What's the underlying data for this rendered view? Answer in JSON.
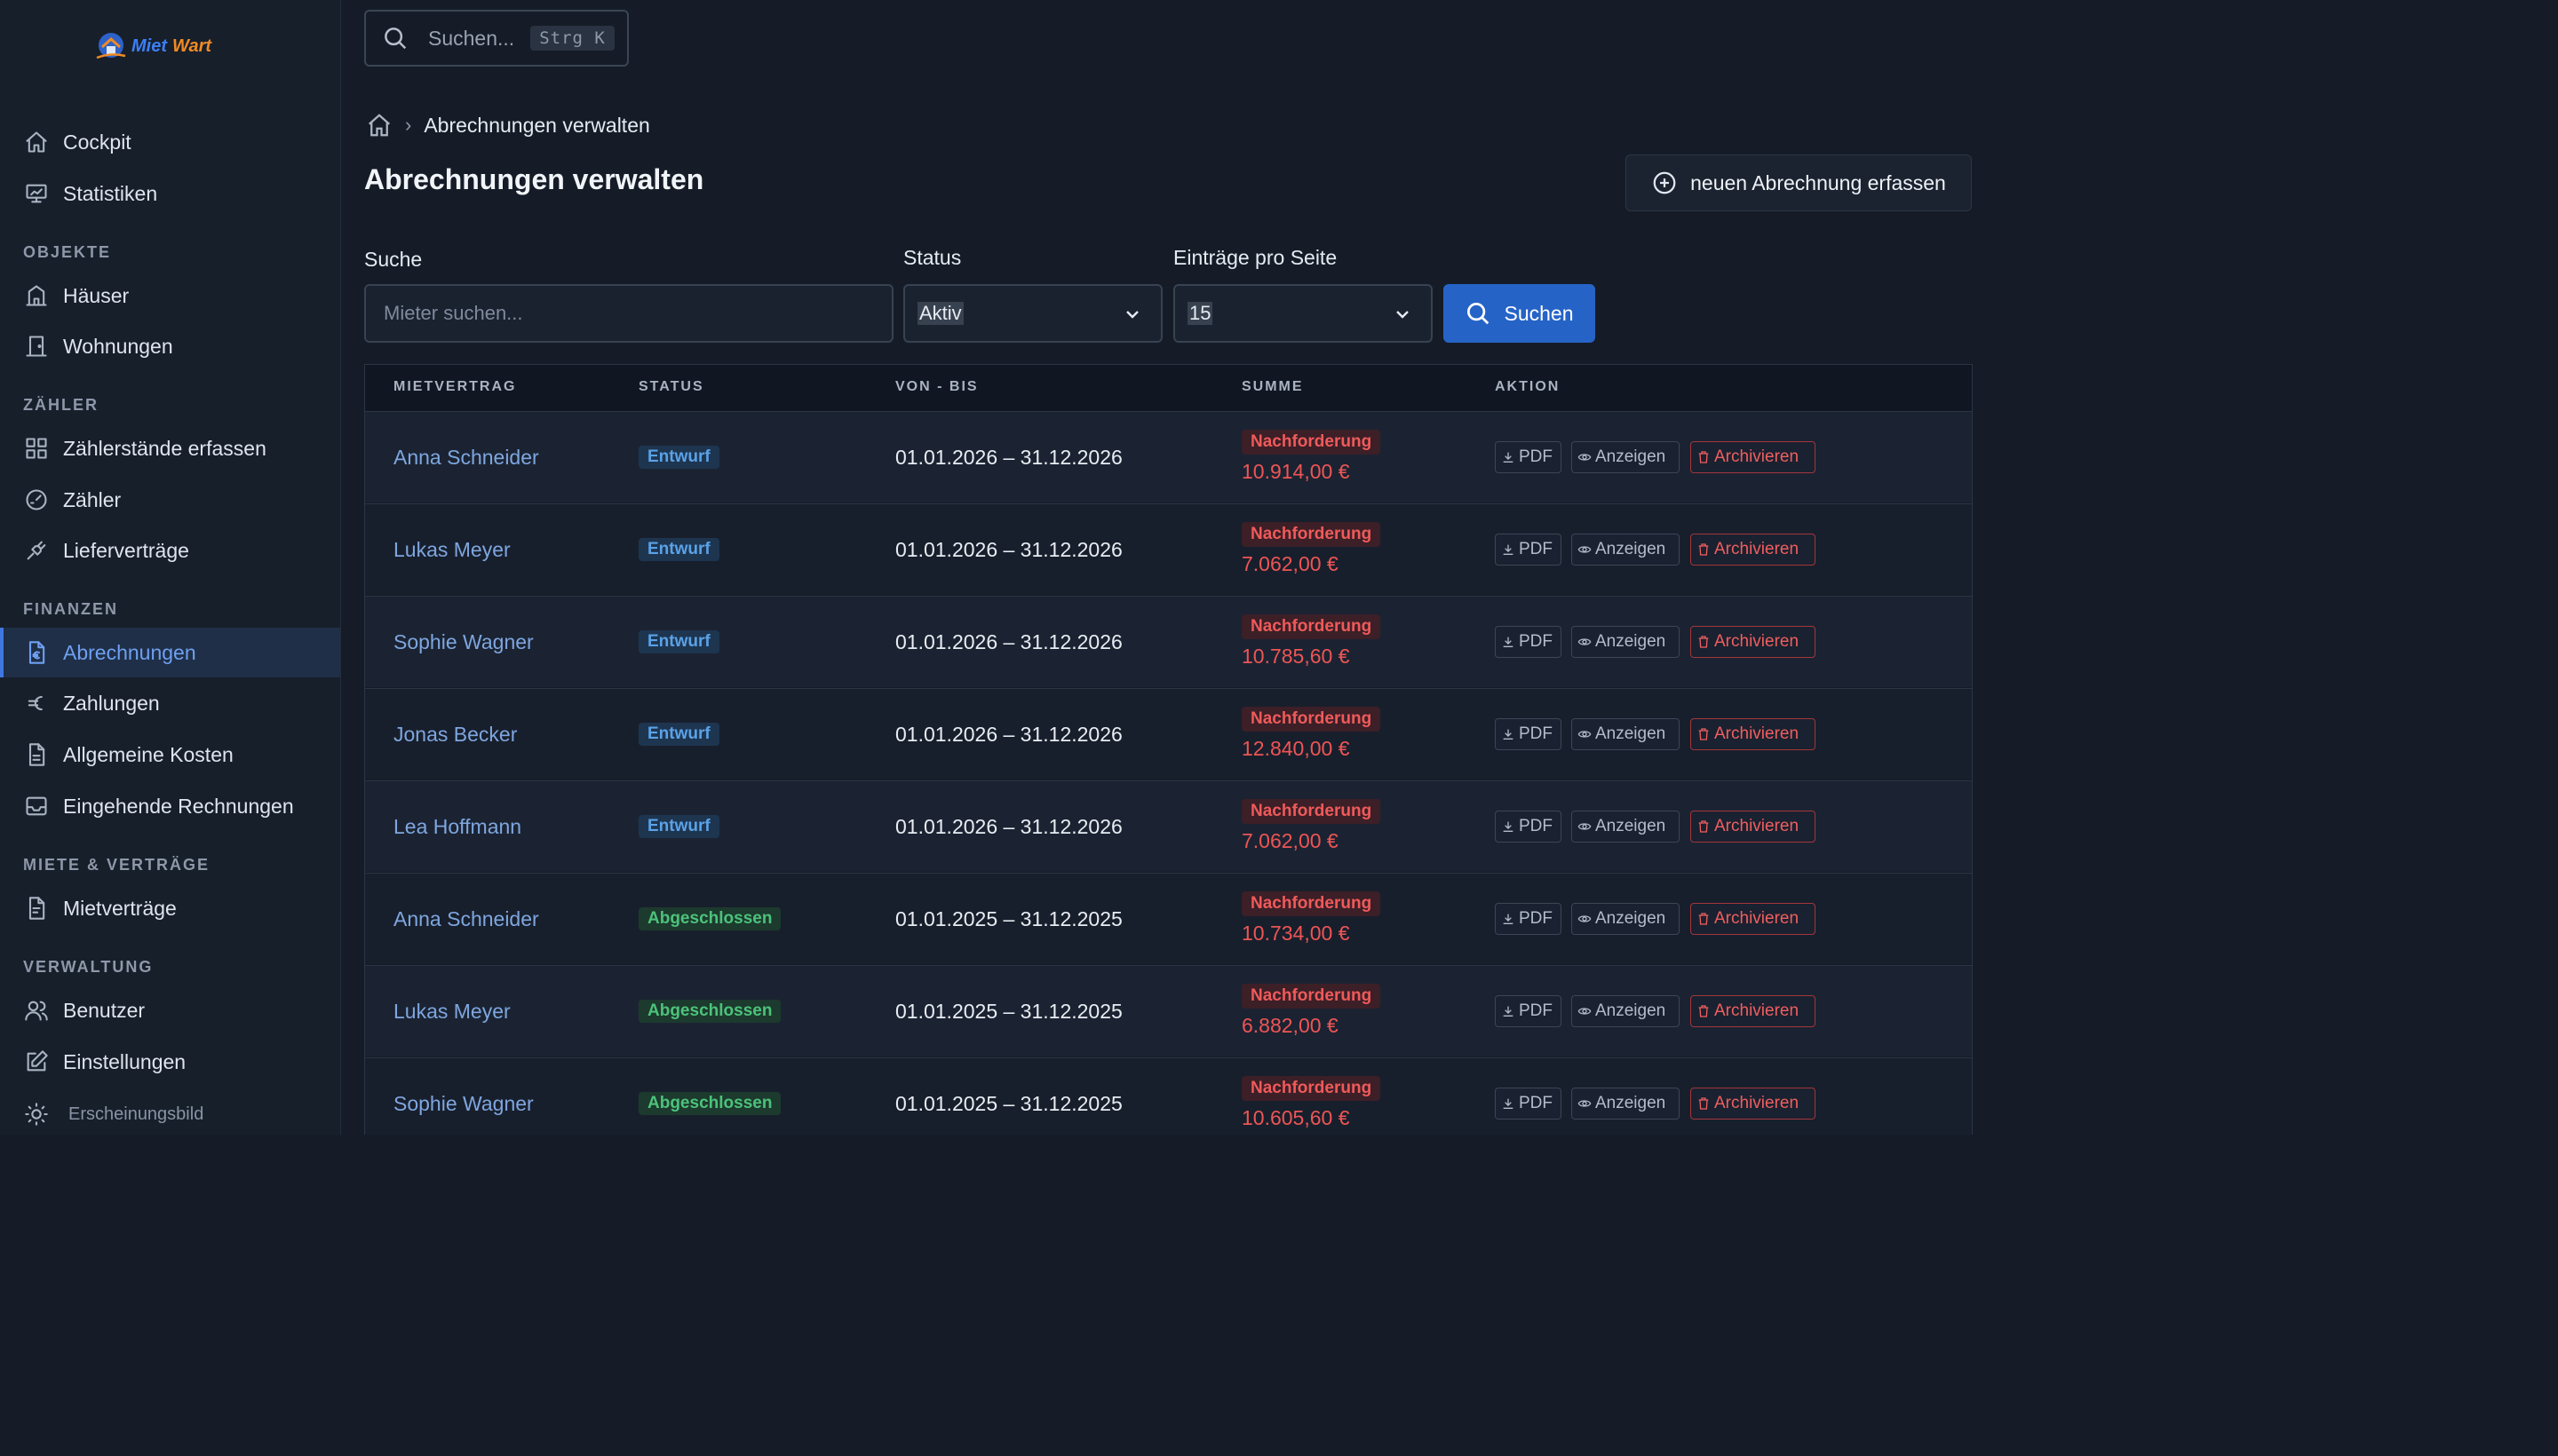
{
  "app": {
    "logo_word1": "Miet",
    "logo_word2": "Wart",
    "colors": {
      "accent": "#2563c7",
      "danger": "#ef5555",
      "success": "#4cc27a",
      "background": "#151c27"
    }
  },
  "sidebar": {
    "top_items": [
      {
        "label": "Cockpit",
        "icon": "home-icon"
      },
      {
        "label": "Statistiken",
        "icon": "monitor-chart-icon"
      }
    ],
    "sections": {
      "objekte": "OBJEKTE",
      "zaehler": "ZÄHLER",
      "finanzen": "FINANZEN",
      "miete": "MIETE & VERTRÄGE",
      "verwaltung": "VERWALTUNG"
    },
    "objekte_items": [
      {
        "label": "Häuser",
        "icon": "building-icon"
      },
      {
        "label": "Wohnungen",
        "icon": "door-icon"
      }
    ],
    "zaehler_items": [
      {
        "label": "Zählerstände erfassen",
        "icon": "grid-icon"
      },
      {
        "label": "Zähler",
        "icon": "gauge-icon"
      },
      {
        "label": "Lieferverträge",
        "icon": "plug-icon"
      }
    ],
    "finanzen_items": [
      {
        "label": "Abrechnungen",
        "icon": "euro-document-icon",
        "active": true
      },
      {
        "label": "Zahlungen",
        "icon": "euro-icon"
      },
      {
        "label": "Allgemeine Kosten",
        "icon": "document-icon"
      },
      {
        "label": "Eingehende Rechnungen",
        "icon": "inbox-icon"
      }
    ],
    "miete_items": [
      {
        "label": "Mietverträge",
        "icon": "contract-icon"
      }
    ],
    "verwaltung_items": [
      {
        "label": "Benutzer",
        "icon": "users-icon"
      },
      {
        "label": "Einstellungen",
        "icon": "edit-icon"
      },
      {
        "label": "Erscheinungsbild",
        "icon": "sun-icon"
      }
    ]
  },
  "header": {
    "search_placeholder": "Suchen...",
    "search_shortcut": "Strg K"
  },
  "breadcrumb": {
    "home_icon": "home-icon",
    "current": "Abrechnungen verwalten"
  },
  "page": {
    "title": "Abrechnungen verwalten",
    "new_button": "neuen Abrechnung erfassen"
  },
  "filters": {
    "search_label": "Suche",
    "search_placeholder": "Mieter suchen...",
    "status_label": "Status",
    "status_value": "Aktiv",
    "per_page_label": "Einträge pro Seite",
    "per_page_value": "15",
    "search_button": "Suchen"
  },
  "table": {
    "columns": [
      "MIETVERTRAG",
      "STATUS",
      "VON - BIS",
      "SUMME",
      "AKTION"
    ],
    "action_labels": {
      "pdf": "PDF",
      "view": "Anzeigen",
      "archive": "Archivieren"
    },
    "rows": [
      {
        "tenant": "Anna Schneider",
        "status": "Entwurf",
        "status_kind": "draft",
        "period": "01.01.2026 – 31.12.2026",
        "sum_type": "Nachforderung",
        "sum": "10.914,00 €"
      },
      {
        "tenant": "Lukas Meyer",
        "status": "Entwurf",
        "status_kind": "draft",
        "period": "01.01.2026 – 31.12.2026",
        "sum_type": "Nachforderung",
        "sum": "7.062,00 €"
      },
      {
        "tenant": "Sophie Wagner",
        "status": "Entwurf",
        "status_kind": "draft",
        "period": "01.01.2026 – 31.12.2026",
        "sum_type": "Nachforderung",
        "sum": "10.785,60 €"
      },
      {
        "tenant": "Jonas Becker",
        "status": "Entwurf",
        "status_kind": "draft",
        "period": "01.01.2026 – 31.12.2026",
        "sum_type": "Nachforderung",
        "sum": "12.840,00 €"
      },
      {
        "tenant": "Lea Hoffmann",
        "status": "Entwurf",
        "status_kind": "draft",
        "period": "01.01.2026 – 31.12.2026",
        "sum_type": "Nachforderung",
        "sum": "7.062,00 €"
      },
      {
        "tenant": "Anna Schneider",
        "status": "Abgeschlossen",
        "status_kind": "done",
        "period": "01.01.2025 – 31.12.2025",
        "sum_type": "Nachforderung",
        "sum": "10.734,00 €"
      },
      {
        "tenant": "Lukas Meyer",
        "status": "Abgeschlossen",
        "status_kind": "done",
        "period": "01.01.2025 – 31.12.2025",
        "sum_type": "Nachforderung",
        "sum": "6.882,00 €"
      },
      {
        "tenant": "Sophie Wagner",
        "status": "Abgeschlossen",
        "status_kind": "done",
        "period": "01.01.2025 – 31.12.2025",
        "sum_type": "Nachforderung",
        "sum": "10.605,60 €"
      }
    ]
  }
}
